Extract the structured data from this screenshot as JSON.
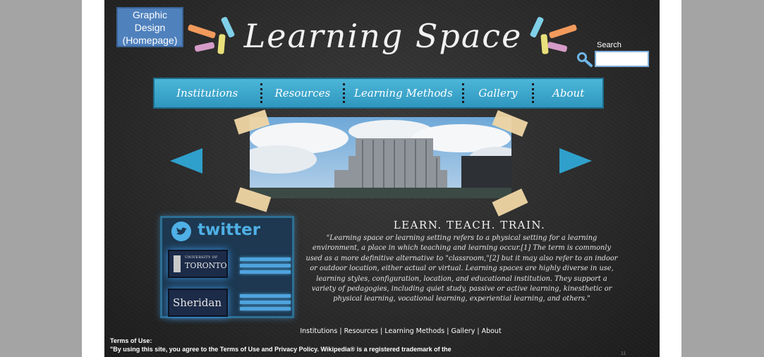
{
  "badge": {
    "line1": "Graphic Design",
    "line2": "(Homepage)"
  },
  "header": {
    "title": "Learning Space"
  },
  "search": {
    "label": "Search",
    "placeholder": ""
  },
  "nav": {
    "items": [
      "Institutions",
      "Resources",
      "Learning Methods",
      "Gallery",
      "About"
    ]
  },
  "twitter": {
    "word": "twitter",
    "university_small": "UNIVERSITY OF",
    "university_name": "TORONTO",
    "college_name": "Sheridan"
  },
  "main": {
    "tagline": "LEARN. TEACH. TRAIN.",
    "paragraph": "\"Learning space or learning setting refers to a physical setting for a learning environment, a place in which teaching and learning occur.[1] The term is commonly used as a more definitive alternative to \"classroom,\"[2] but it may also refer to an indoor or outdoor location, either actual or virtual. Learning spaces are highly diverse in use, learning styles, configuration, location, and educational institution. They support a variety of pedagogies, including quiet study, passive or active learning, kinesthetic or physical learning, vocational learning, experiential learning, and others.\""
  },
  "footer": {
    "links": [
      "Institutions",
      "Resources",
      "Learning Methods",
      "Gallery",
      "About"
    ],
    "separator": " | ",
    "terms_title": "Terms of Use:",
    "terms_text": "\"By using this site, you agree to the Terms of Use and Privacy Policy. Wikipedia® is a registered trademark of the",
    "page_number": "11"
  },
  "colors": {
    "gutter": "#a4a4a4",
    "board": "#2b2b2b",
    "nav": "#3aa6cc",
    "badge": "#4f81bd",
    "arrow": "#2fa0cc"
  },
  "icons": {
    "search": "magnifier-icon",
    "prev": "triangle-left-icon",
    "next": "triangle-right-icon",
    "twitter": "twitter-bird-icon"
  }
}
